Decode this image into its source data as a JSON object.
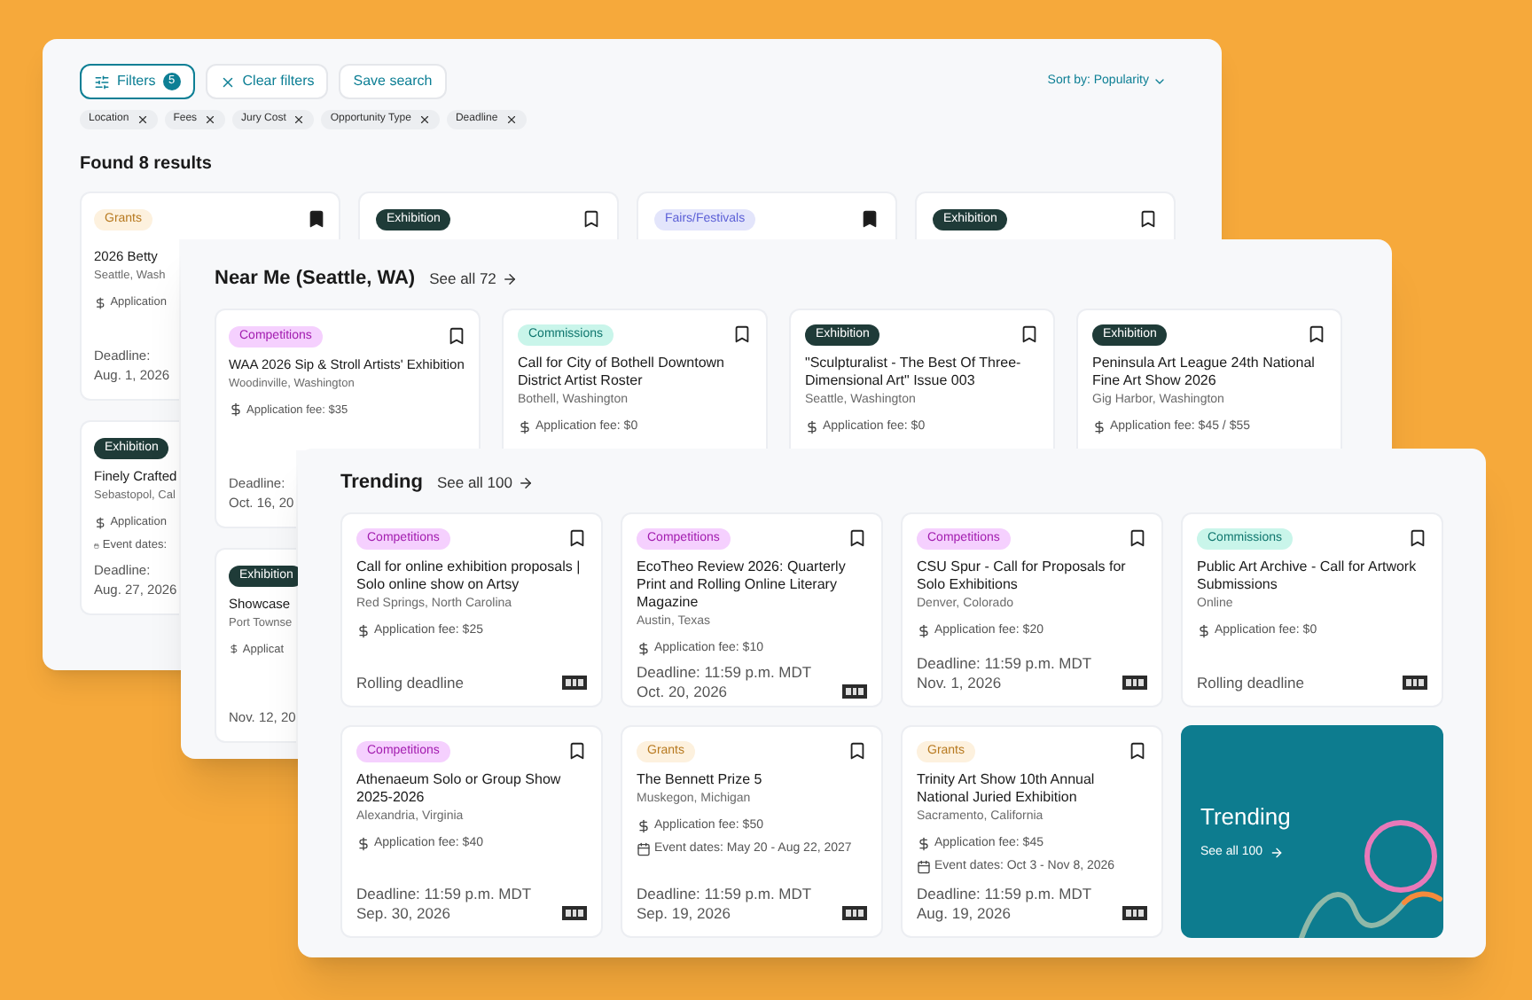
{
  "search_panel": {
    "filters_button": {
      "label": "Filters",
      "count": "5"
    },
    "clear_button": "Clear filters",
    "save_button": "Save search",
    "sort": "Sort by: Popularity",
    "chips": [
      "Location",
      "Fees",
      "Jury Cost",
      "Opportunity Type",
      "Deadline"
    ],
    "results_heading": "Found 8 results",
    "cards": [
      {
        "tag": "Grants",
        "kind": "grants",
        "saved": true,
        "title": "2026 Betty",
        "location": "Seattle, Wash",
        "fee": "Application",
        "deadline": [
          "Deadline:",
          "Aug. 1, 2026"
        ]
      },
      {
        "tag": "Exhibition",
        "kind": "exhibition",
        "saved": false
      },
      {
        "tag": "Fairs/Festivals",
        "kind": "fairs",
        "saved": true
      },
      {
        "tag": "Exhibition",
        "kind": "exhibition",
        "saved": false
      },
      {
        "tag": "Exhibition",
        "kind": "exhibition",
        "title": "Finely Crafted",
        "location": "Sebastopol, Cal",
        "fee": "Application",
        "event_dates": "Event dates:",
        "deadline": [
          "Deadline:",
          "Aug. 27, 2026"
        ]
      }
    ]
  },
  "near_me": {
    "title": "Near Me (Seattle, WA)",
    "see_all": "See all 72",
    "cards": [
      {
        "tag": "Competitions",
        "kind": "competitions",
        "saved": false,
        "title": "WAA 2026 Sip & Stroll Artists' Exhibition",
        "location": "Woodinville, Washington",
        "fee": "Application fee: $35",
        "deadline": [
          "Deadline:",
          "Oct. 16, 20"
        ]
      },
      {
        "tag": "Commissions",
        "kind": "commissions",
        "saved": false,
        "title": "Call for City of Bothell Downtown District Artist Roster",
        "location": "Bothell, Washington",
        "fee": "Application fee: $0"
      },
      {
        "tag": "Exhibition",
        "kind": "exhibition",
        "saved": false,
        "title": "\"Sculpturalist - The Best Of Three-Dimensional Art\" Issue 003",
        "location": "Seattle, Washington",
        "fee": "Application fee: $0"
      },
      {
        "tag": "Exhibition",
        "kind": "exhibition",
        "saved": false,
        "title": "Peninsula Art League 24th National Fine Art Show 2026",
        "location": "Gig Harbor, Washington",
        "fee": "Application fee: $45 / $55"
      },
      {
        "tag": "Exhibition",
        "kind": "exhibition",
        "title": "Showcase",
        "location": "Port Townse",
        "fee": "Applicat",
        "deadline": [
          "Nov. 12, 20"
        ]
      }
    ]
  },
  "trending": {
    "title": "Trending",
    "see_all": "See all 100",
    "cards": [
      {
        "tag": "Competitions",
        "kind": "competitions",
        "saved": false,
        "title": "Call for online exhibition proposals | Solo online show on Artsy",
        "location": "Red Springs, North Carolina",
        "fee": "Application fee: $25",
        "deadline": [
          "Rolling deadline"
        ],
        "stamp": true
      },
      {
        "tag": "Competitions",
        "kind": "competitions",
        "saved": false,
        "title": "EcoTheo Review 2026: Quarterly Print and Rolling Online Literary Magazine",
        "location": "Austin, Texas",
        "fee": "Application fee: $10",
        "deadline": [
          "Deadline: 11:59 p.m. MDT",
          "Oct. 20, 2026"
        ],
        "stamp": true
      },
      {
        "tag": "Competitions",
        "kind": "competitions",
        "saved": false,
        "title": "CSU Spur - Call for Proposals for Solo Exhibitions",
        "location": "Denver, Colorado",
        "fee": "Application fee: $20",
        "deadline": [
          "Deadline: 11:59 p.m. MDT",
          "Nov. 1, 2026"
        ],
        "stamp": true
      },
      {
        "tag": "Commissions",
        "kind": "commissions",
        "saved": false,
        "title": "Public Art Archive - Call for Artwork Submissions",
        "location": "Online",
        "fee": "Application fee: $0",
        "deadline": [
          "Rolling deadline"
        ],
        "stamp": true
      },
      {
        "tag": "Competitions",
        "kind": "competitions",
        "saved": false,
        "title": "Athenaeum Solo or Group Show 2025-2026",
        "location": "Alexandria, Virginia",
        "fee": "Application fee: $40",
        "deadline": [
          "Deadline: 11:59 p.m. MDT",
          "Sep. 30, 2026"
        ],
        "stamp": true
      },
      {
        "tag": "Grants",
        "kind": "grants",
        "saved": false,
        "title": "The Bennett Prize 5",
        "location": "Muskegon, Michigan",
        "fee": "Application fee: $50",
        "event_dates": "Event dates: May 20 - Aug 22, 2027",
        "deadline": [
          "Deadline: 11:59 p.m. MDT",
          "Sep. 19, 2026"
        ],
        "stamp": true
      },
      {
        "tag": "Grants",
        "kind": "grants",
        "saved": false,
        "title": "Trinity Art Show 10th Annual National Juried Exhibition",
        "location": "Sacramento, California",
        "fee": "Application fee: $45",
        "event_dates": "Event dates: Oct 3 - Nov 8, 2026",
        "deadline": [
          "Deadline: 11:59 p.m. MDT",
          "Aug. 19, 2026"
        ],
        "stamp": true
      }
    ],
    "promo": {
      "title": "Trending",
      "link": "See all 100"
    }
  }
}
